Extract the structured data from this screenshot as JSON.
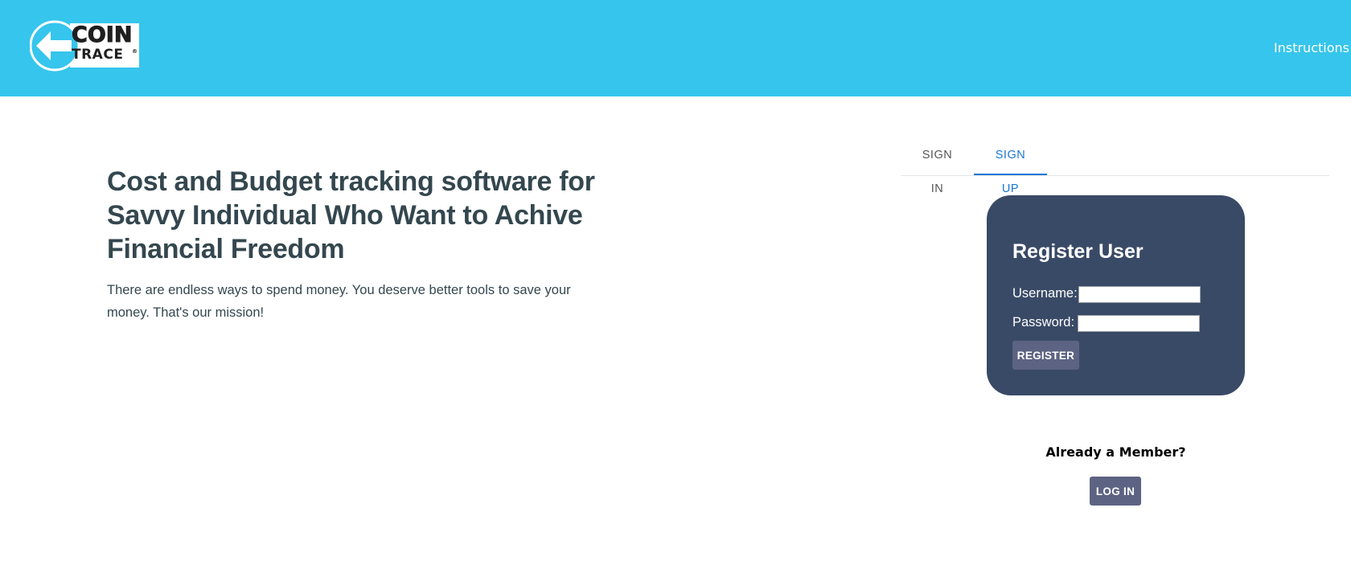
{
  "header": {
    "logo": {
      "line1": "COIN",
      "line2": "TRACE",
      "mark": "®"
    },
    "nav_instructions": "Instructions",
    "background_color": "#36c5ec"
  },
  "hero": {
    "title": "Cost and Budget tracking software for Savvy Individual Who Want to Achive Financial Freedom",
    "description": "There are endless ways to spend money. You deserve better tools to save your money. That's our mission!"
  },
  "auth_tabs": {
    "items": [
      {
        "label": "SIGN IN",
        "active": false
      },
      {
        "label": "SIGN UP",
        "active": true
      }
    ],
    "active_color": "#1976d2"
  },
  "register": {
    "title": "Register User",
    "username_label": "Username:",
    "username_value": "",
    "password_label": "Password:",
    "password_value": "",
    "button_label": "REGISTER",
    "card_color": "#394a66",
    "button_color": "#5d6382"
  },
  "member": {
    "prompt": "Already a Member?",
    "login_label": "LOG IN"
  }
}
